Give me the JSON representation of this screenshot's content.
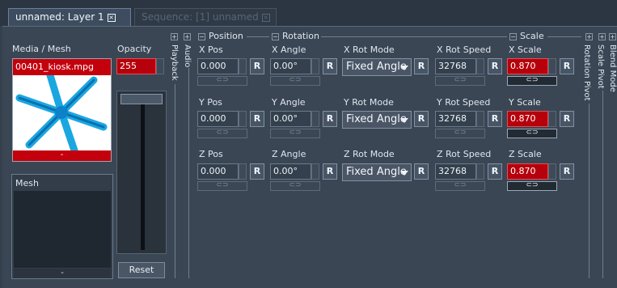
{
  "tabs": [
    {
      "label": "unnamed: Layer 1"
    },
    {
      "label": "Sequence: [1] unnamed"
    }
  ],
  "media": {
    "header": "Media / Mesh",
    "file_name": "00401_kiosk.mpg",
    "footer": "-"
  },
  "mesh": {
    "title": "Mesh",
    "footer": "-"
  },
  "opacity": {
    "label": "Opacity",
    "value": "255",
    "slider_level": 1.0,
    "reset_label": "Reset"
  },
  "side_labels": {
    "playback": "Playback",
    "audio": "Audio"
  },
  "sections": {
    "position": "Position",
    "rotation": "Rotation",
    "scale": "Scale"
  },
  "right_labels": {
    "rotation_pivot": "Rotation Pivot",
    "scale_pivot": "Scale Pivot",
    "blend_mode": "Blend Mode"
  },
  "r_label": "R",
  "rows": [
    {
      "pos_label": "X Pos",
      "pos": "0.000",
      "angle_label": "X Angle",
      "angle": "0.00°",
      "mode_label": "X Rot Mode",
      "mode": "Fixed Angle",
      "speed_label": "X Rot Speed",
      "speed": "32768",
      "scale_label": "X Scale",
      "scale": "0.870"
    },
    {
      "pos_label": "Y Pos",
      "pos": "0.000",
      "angle_label": "Y Angle",
      "angle": "0.00°",
      "mode_label": "Y Rot Mode",
      "mode": "Fixed Angle",
      "speed_label": "Y Rot Speed",
      "speed": "32768",
      "scale_label": "Y Scale",
      "scale": "0.870"
    },
    {
      "pos_label": "Z Pos",
      "pos": "0.000",
      "angle_label": "Z Angle",
      "angle": "0.00°",
      "mode_label": "Z Rot Mode",
      "mode": "Fixed Angle",
      "speed_label": "Z Rot Speed",
      "speed": "32768",
      "scale_label": "Z Scale",
      "scale": "0.870"
    }
  ],
  "icons": {
    "link": "chain-link-icon",
    "close": "close-tab-icon",
    "dropdown": "chevron-down-icon"
  },
  "colors": {
    "accent_red": "#b6000b",
    "panel_bg": "#3a4654",
    "tab_active": "#3d4d5f"
  }
}
